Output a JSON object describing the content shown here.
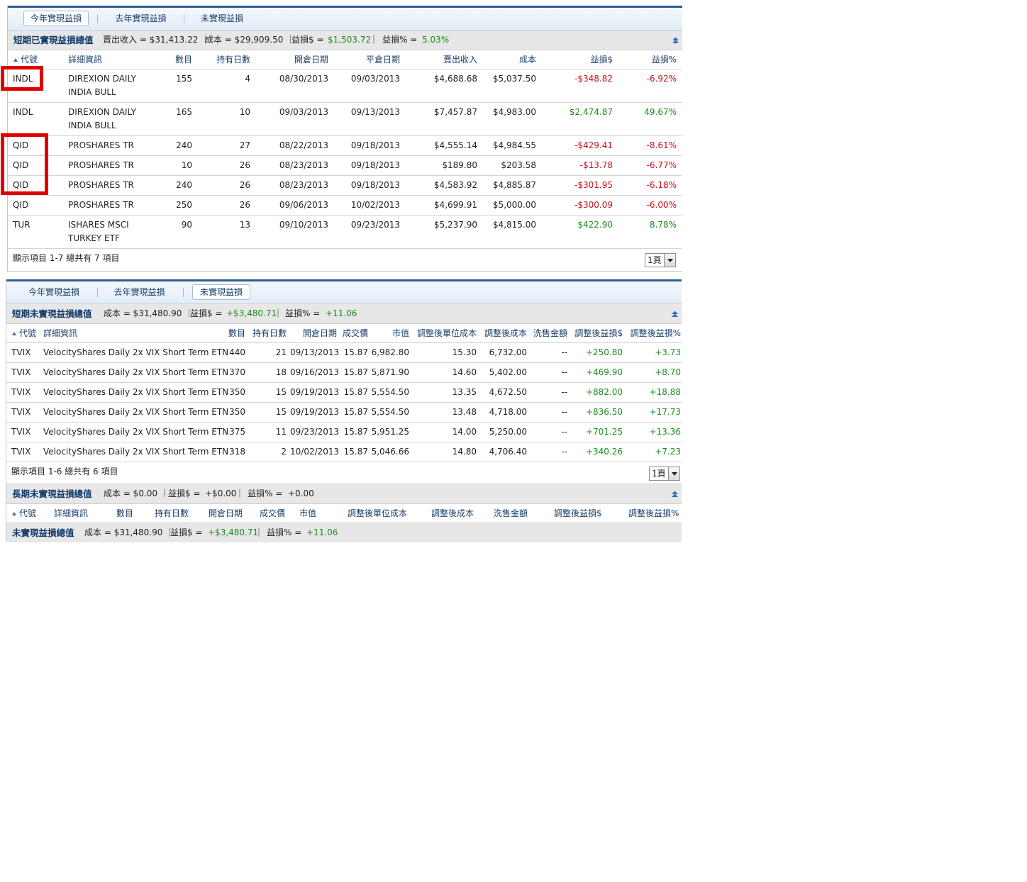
{
  "panel1": {
    "tabs": [
      "今年實現益損",
      "去年實現益損",
      "未實現益損"
    ],
    "summary": {
      "title": "短期已實現益損總值",
      "sales_label": "賣出收入 = $31,413.22 ｜",
      "cost_label": "成本 = $29,909.50 ｜",
      "pl_label": "益損$ =",
      "pl_value": "$1,503.72",
      "sep": "｜",
      "pct_label": "益損% =",
      "pct_value": "5.03%"
    },
    "headers": [
      "代號",
      "詳細資訊",
      "數目",
      "持有日數",
      "開倉日期",
      "平倉日期",
      "賣出收入",
      "成本",
      "益損$",
      "益損%"
    ],
    "rows": [
      {
        "symbol": "INDL",
        "desc1": "DIREXION DAILY",
        "desc2": "INDIA BULL",
        "qty": "155",
        "days": "4",
        "open": "08/30/2013",
        "close": "09/03/2013",
        "proceeds": "$4,688.68",
        "cost": "$5,037.50",
        "pl": "-$348.82",
        "pct": "-6.92%",
        "neg": true
      },
      {
        "symbol": "INDL",
        "desc1": "DIREXION DAILY",
        "desc2": "INDIA BULL",
        "qty": "165",
        "days": "10",
        "open": "09/03/2013",
        "close": "09/13/2013",
        "proceeds": "$7,457.87",
        "cost": "$4,983.00",
        "pl": "$2,474.87",
        "pct": "49.67%",
        "neg": false
      },
      {
        "symbol": "QID",
        "desc1": "PROSHARES TR",
        "desc2": "",
        "qty": "240",
        "days": "27",
        "open": "08/22/2013",
        "close": "09/18/2013",
        "proceeds": "$4,555.14",
        "cost": "$4,984.55",
        "pl": "-$429.41",
        "pct": "-8.61%",
        "neg": true
      },
      {
        "symbol": "QID",
        "desc1": "PROSHARES TR",
        "desc2": "",
        "qty": "10",
        "days": "26",
        "open": "08/23/2013",
        "close": "09/18/2013",
        "proceeds": "$189.80",
        "cost": "$203.58",
        "pl": "-$13.78",
        "pct": "-6.77%",
        "neg": true
      },
      {
        "symbol": "QID",
        "desc1": "PROSHARES TR",
        "desc2": "",
        "qty": "240",
        "days": "26",
        "open": "08/23/2013",
        "close": "09/18/2013",
        "proceeds": "$4,583.92",
        "cost": "$4,885.87",
        "pl": "-$301.95",
        "pct": "-6.18%",
        "neg": true
      },
      {
        "symbol": "QID",
        "desc1": "PROSHARES TR",
        "desc2": "",
        "qty": "250",
        "days": "26",
        "open": "09/06/2013",
        "close": "10/02/2013",
        "proceeds": "$4,699.91",
        "cost": "$5,000.00",
        "pl": "-$300.09",
        "pct": "-6.00%",
        "neg": true
      },
      {
        "symbol": "TUR",
        "desc1": "ISHARES MSCI",
        "desc2": "TURKEY ETF",
        "qty": "90",
        "days": "13",
        "open": "09/10/2013",
        "close": "09/23/2013",
        "proceeds": "$5,237.90",
        "cost": "$4,815.00",
        "pl": "$422.90",
        "pct": "8.78%",
        "neg": false
      }
    ],
    "footer_text": "顯示項目 1-7 總共有 7 項目",
    "page_label": "1頁"
  },
  "panel2": {
    "tabs": [
      "今年實現益損",
      "去年實現益損",
      "未實現益損"
    ],
    "summary": {
      "title": "短期未實現益損總值",
      "cost_label": "成本 = $31,480.90 ｜",
      "pl_label": "益損$ =",
      "pl_value": "+$3,480.71",
      "sep": "｜",
      "pct_label": "益損% =",
      "pct_value": "+11.06"
    },
    "headers": [
      "代號",
      "詳細資訊",
      "數目",
      "持有日數",
      "開倉日期",
      "成交價",
      "市值",
      "調整後單位成本",
      "調整後成本",
      "洗售金額",
      "調整後益損$",
      "調整後益損%"
    ],
    "rows": [
      {
        "symbol": "TVIX",
        "desc": "VelocityShares Daily 2x VIX Short Term ETN",
        "qty": "440",
        "days": "21",
        "open": "09/13/2013",
        "price": "15.87",
        "mv": "6,982.80",
        "ucost": "15.30",
        "acost": "6,732.00",
        "wash": "--",
        "pl": "+250.80",
        "pct": "+3.73"
      },
      {
        "symbol": "TVIX",
        "desc": "VelocityShares Daily 2x VIX Short Term ETN",
        "qty": "370",
        "days": "18",
        "open": "09/16/2013",
        "price": "15.87",
        "mv": "5,871.90",
        "ucost": "14.60",
        "acost": "5,402.00",
        "wash": "--",
        "pl": "+469.90",
        "pct": "+8.70"
      },
      {
        "symbol": "TVIX",
        "desc": "VelocityShares Daily 2x VIX Short Term ETN",
        "qty": "350",
        "days": "15",
        "open": "09/19/2013",
        "price": "15.87",
        "mv": "5,554.50",
        "ucost": "13.35",
        "acost": "4,672.50",
        "wash": "--",
        "pl": "+882.00",
        "pct": "+18.88"
      },
      {
        "symbol": "TVIX",
        "desc": "VelocityShares Daily 2x VIX Short Term ETN",
        "qty": "350",
        "days": "15",
        "open": "09/19/2013",
        "price": "15.87",
        "mv": "5,554.50",
        "ucost": "13.48",
        "acost": "4,718.00",
        "wash": "--",
        "pl": "+836.50",
        "pct": "+17.73"
      },
      {
        "symbol": "TVIX",
        "desc": "VelocityShares Daily 2x VIX Short Term ETN",
        "qty": "375",
        "days": "11",
        "open": "09/23/2013",
        "price": "15.87",
        "mv": "5,951.25",
        "ucost": "14.00",
        "acost": "5,250.00",
        "wash": "--",
        "pl": "+701.25",
        "pct": "+13.36"
      },
      {
        "symbol": "TVIX",
        "desc": "VelocityShares Daily 2x VIX Short Term ETN",
        "qty": "318",
        "days": "2",
        "open": "10/02/2013",
        "price": "15.87",
        "mv": "5,046.66",
        "ucost": "14.80",
        "acost": "4,706.40",
        "wash": "--",
        "pl": "+340.26",
        "pct": "+7.23"
      }
    ],
    "footer_text": "顯示項目 1-6 總共有 6 項目",
    "page_label": "1頁",
    "long_summary": {
      "title": "長期未實現益損總值",
      "cost_label": "成本 = $0.00 ｜",
      "pl_label": "益損$ =",
      "pl_value": "+$0.00",
      "sep": "｜",
      "pct_label": "益損% =",
      "pct_value": "+0.00"
    },
    "long_headers": [
      "代號",
      "詳細資訊",
      "數目",
      "持有日數",
      "開倉日期",
      "成交價",
      "市值",
      "調整後單位成本",
      "調整後成本",
      "洗售金額",
      "調整後益損$",
      "調整後益損%"
    ],
    "total_summary": {
      "title": "未實現益損總值",
      "cost_label": "成本 = $31,480.90 ｜",
      "pl_label": "益損$ =",
      "pl_value": "+$3,480.71",
      "sep": "｜",
      "pct_label": "益損% =",
      "pct_value": "+11.06"
    }
  },
  "colors": {
    "positive": "#1a8e1a",
    "negative": "#c8101a",
    "header_text": "#1a3e6b",
    "highlight": "#e00000"
  }
}
